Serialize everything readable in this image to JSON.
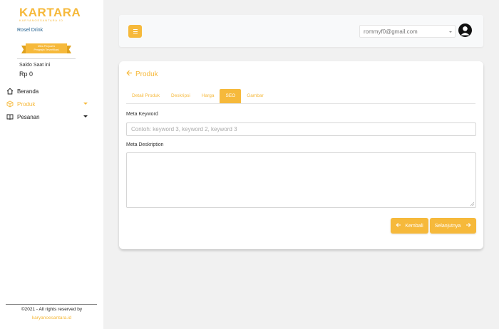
{
  "sidebar": {
    "logo": {
      "main": "KARTARA",
      "sub": "KARYANOESANTARA.ID"
    },
    "store_name": "Rosel Drink",
    "badge_line1": "Mitra Penjual &",
    "badge_line2": "Pengrajin Terverifikasi",
    "saldo_label": "Saldo Saat ini",
    "saldo_value": "Rp 0",
    "nav": [
      {
        "label": "Beranda",
        "icon": "home-icon"
      },
      {
        "label": "Produk",
        "icon": "box-icon"
      },
      {
        "label": "Pesanan",
        "icon": "book-icon"
      }
    ],
    "footer_copy": "©2021 - All rights reserved by",
    "footer_link": "karyanoesantara.id"
  },
  "header": {
    "menu_icon": "hamburger-icon",
    "user_email": "rommyf0@gmail.com",
    "avatar_icon": "user-avatar-icon"
  },
  "card": {
    "title": "Produk",
    "tabs": [
      {
        "label": "Detail Produk"
      },
      {
        "label": "Deskripsi"
      },
      {
        "label": "Harga"
      },
      {
        "label": "SEO"
      },
      {
        "label": "Gambar"
      }
    ],
    "active_tab": "SEO",
    "meta_keyword_label": "Meta Keyword",
    "meta_keyword_placeholder": "Contoh: keyword 3, keyword 2, keyword 3",
    "meta_keyword_value": "",
    "meta_description_label": "Meta Deskription",
    "meta_description_value": "",
    "back_button": "Kembali",
    "next_button": "Selanjutnya"
  },
  "colors": {
    "accent": "#f6b93b",
    "sidebar_bg": "#ffffff",
    "page_bg": "#f1f1f1",
    "store_name": "#1d5c8c"
  }
}
